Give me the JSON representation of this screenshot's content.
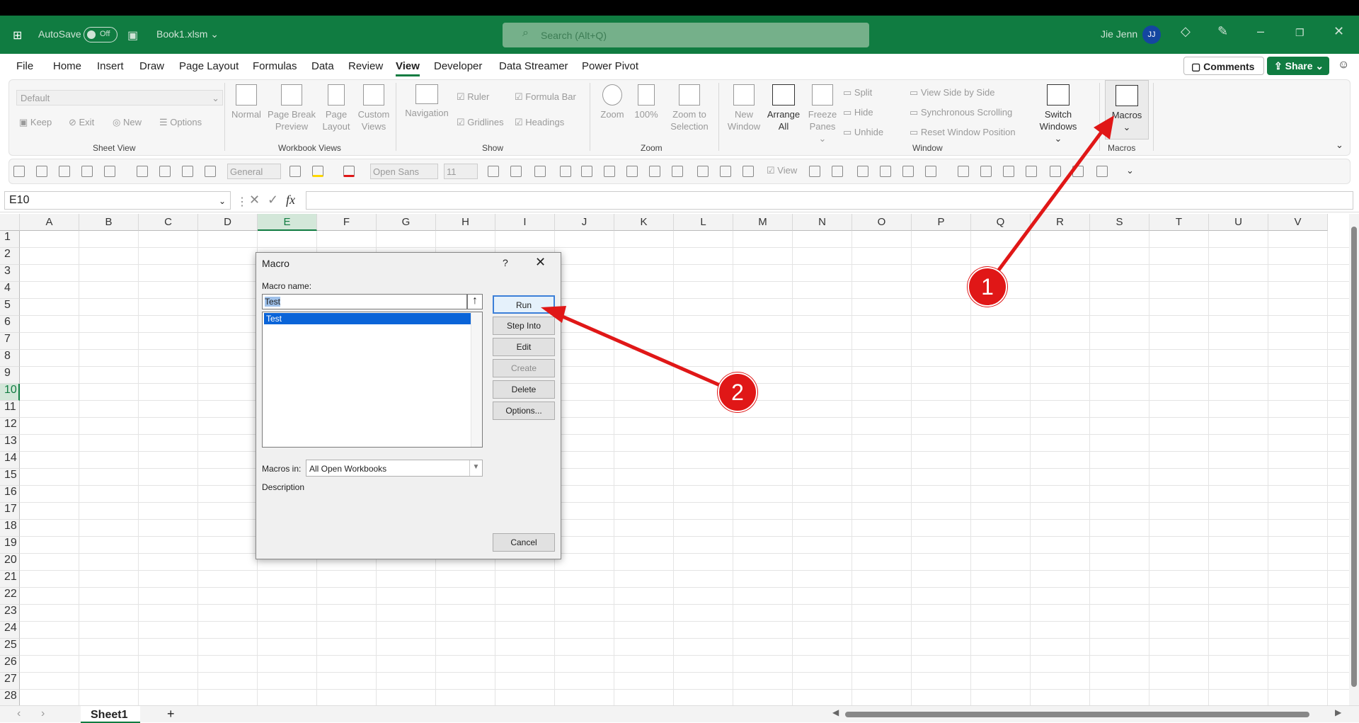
{
  "titlebar": {
    "autosave_label": "AutoSave",
    "autosave_state": "Off",
    "file_name": "Book1.xlsm",
    "search_placeholder": "Search (Alt+Q)",
    "user_name": "Jie Jenn",
    "user_initials": "JJ"
  },
  "menu": {
    "items": [
      "File",
      "Home",
      "Insert",
      "Draw",
      "Page Layout",
      "Formulas",
      "Data",
      "Review",
      "View",
      "Developer",
      "Data Streamer",
      "Power Pivot"
    ],
    "active": "View",
    "comments": "Comments",
    "share": "Share"
  },
  "ribbon": {
    "sheet_view": {
      "dropdown": "Default",
      "keep": "Keep",
      "exit": "Exit",
      "new": "New",
      "options": "Options",
      "label": "Sheet View"
    },
    "workbook_views": {
      "normal": "Normal",
      "page_break_1": "Page Break",
      "page_break_2": "Preview",
      "page_layout_1": "Page",
      "page_layout_2": "Layout",
      "custom_1": "Custom",
      "custom_2": "Views",
      "label": "Workbook Views"
    },
    "show": {
      "navigation": "Navigation",
      "ruler": "Ruler",
      "formula_bar": "Formula Bar",
      "gridlines": "Gridlines",
      "headings": "Headings",
      "label": "Show"
    },
    "zoom": {
      "zoom": "Zoom",
      "pct": "100%",
      "zoom_sel_1": "Zoom to",
      "zoom_sel_2": "Selection",
      "label": "Zoom"
    },
    "window": {
      "new_window_1": "New",
      "new_window_2": "Window",
      "arrange_1": "Arrange",
      "arrange_2": "All",
      "freeze_1": "Freeze",
      "freeze_2": "Panes",
      "split": "Split",
      "hide": "Hide",
      "unhide": "Unhide",
      "side_by_side": "View Side by Side",
      "sync_scroll": "Synchronous Scrolling",
      "reset_pos": "Reset Window Position",
      "switch_1": "Switch",
      "switch_2": "Windows",
      "label": "Window"
    },
    "macros": {
      "macros": "Macros",
      "label": "Macros"
    }
  },
  "qat": {
    "number_format": "General",
    "font": "Open Sans",
    "font_size": "11",
    "view": "View"
  },
  "formula_bar": {
    "name_box": "E10",
    "fx": "fx",
    "formula": ""
  },
  "grid": {
    "columns": [
      "A",
      "B",
      "C",
      "D",
      "E",
      "F",
      "G",
      "H",
      "I",
      "J",
      "K",
      "L",
      "M",
      "N",
      "O",
      "P",
      "Q",
      "R",
      "S",
      "T",
      "U",
      "V"
    ],
    "rows": [
      "1",
      "2",
      "3",
      "4",
      "5",
      "6",
      "7",
      "8",
      "9",
      "10",
      "11",
      "12",
      "13",
      "14",
      "15",
      "16",
      "17",
      "18",
      "19",
      "20",
      "21",
      "22",
      "23",
      "24",
      "25",
      "26",
      "27",
      "28"
    ],
    "selected_column": "E",
    "selected_row": "10"
  },
  "sheets": {
    "tabs": [
      "Sheet1"
    ],
    "add": "+"
  },
  "dialog": {
    "title": "Macro",
    "help": "?",
    "close": "✕",
    "macro_name_label": "Macro name:",
    "macro_name_value": "Test",
    "list_items": [
      "Test"
    ],
    "buttons": {
      "run": "Run",
      "step_into": "Step Into",
      "edit": "Edit",
      "create": "Create",
      "delete": "Delete",
      "options": "Options...",
      "cancel": "Cancel"
    },
    "macros_in_label": "Macros in:",
    "macros_in_value": "All Open Workbooks",
    "description_label": "Description"
  },
  "annotations": {
    "step1": "1",
    "step2": "2",
    "color": "#e01717"
  }
}
